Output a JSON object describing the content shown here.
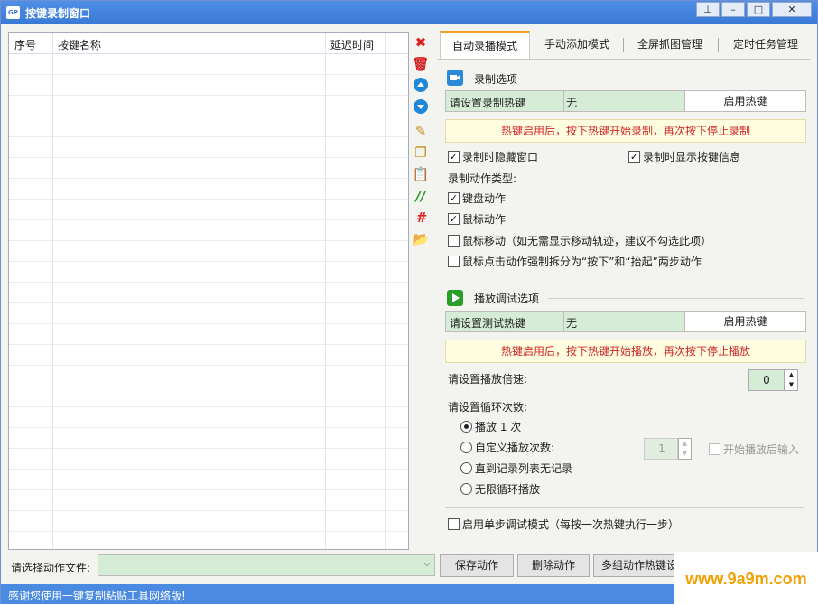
{
  "window": {
    "title": "按键录制窗口",
    "app_icon_text": "GP",
    "buttons": [
      "pin",
      "minimize",
      "maximize",
      "close"
    ]
  },
  "list": {
    "columns": [
      "序号",
      "按键名称",
      "延迟时间"
    ],
    "rows": []
  },
  "sidebar_tools": [
    {
      "icon": "delete-x-icon",
      "color": "#e02020"
    },
    {
      "icon": "trash-icon",
      "color": "#d02020"
    },
    {
      "icon": "arrow-up-icon",
      "color": "#1e88d8"
    },
    {
      "icon": "arrow-down-icon",
      "color": "#1e88d8"
    },
    {
      "icon": "edit-icon",
      "color": "#c89020"
    },
    {
      "icon": "copy-icon",
      "color": "#c89020"
    },
    {
      "icon": "paste-icon",
      "color": "#c89020"
    },
    {
      "icon": "comment-icon",
      "color": "#2a9a2a"
    },
    {
      "icon": "hash-icon",
      "color": "#e02020"
    },
    {
      "icon": "folder-icon",
      "color": "#e0b040"
    }
  ],
  "tabs": [
    "自动录播模式",
    "手动添加模式",
    "全屏抓图管理",
    "定时任务管理"
  ],
  "record": {
    "section_title": "录制选项",
    "hotkey_label": "请设置录制热键",
    "hotkey_value": "无",
    "enable_button": "启用热键",
    "notice": "热键启用后，按下热键开始录制，再次按下停止录制",
    "hide_window": "录制时隐藏窗口",
    "show_key_info": "录制时显示按键信息",
    "action_type_label": "录制动作类型:",
    "keyboard_action": "键盘动作",
    "mouse_action": "鼠标动作",
    "mouse_move": "鼠标移动（如无需显示移动轨迹，建议不勾选此项）",
    "mouse_click_split": "鼠标点击动作强制拆分为“按下”和“抬起”两步动作"
  },
  "playback": {
    "section_title": "播放调试选项",
    "hotkey_label": "请设置测试热键",
    "hotkey_value": "无",
    "enable_button": "启用热键",
    "notice": "热键启用后，按下热键开始播放，再次按下停止播放",
    "speed_label": "请设置播放倍速:",
    "speed_value": "0",
    "loop_label": "请设置循环次数:",
    "play_once": "播放 1 次",
    "custom_count": "自定义播放次数:",
    "custom_value": "1",
    "start_input": "开始播放后输入",
    "until_empty": "直到记录列表无记录",
    "infinite": "无限循环播放",
    "single_step": "启用单步调试模式（每按一次热键执行一步）"
  },
  "bottom": {
    "file_label": "请选择动作文件:",
    "save_action": "保存动作",
    "delete_action": "删除动作",
    "multi_hotkey": "多组动作热键设"
  },
  "status": "感谢您使用一键复制粘贴工具网络版!",
  "watermark": "www.9a9m.com"
}
